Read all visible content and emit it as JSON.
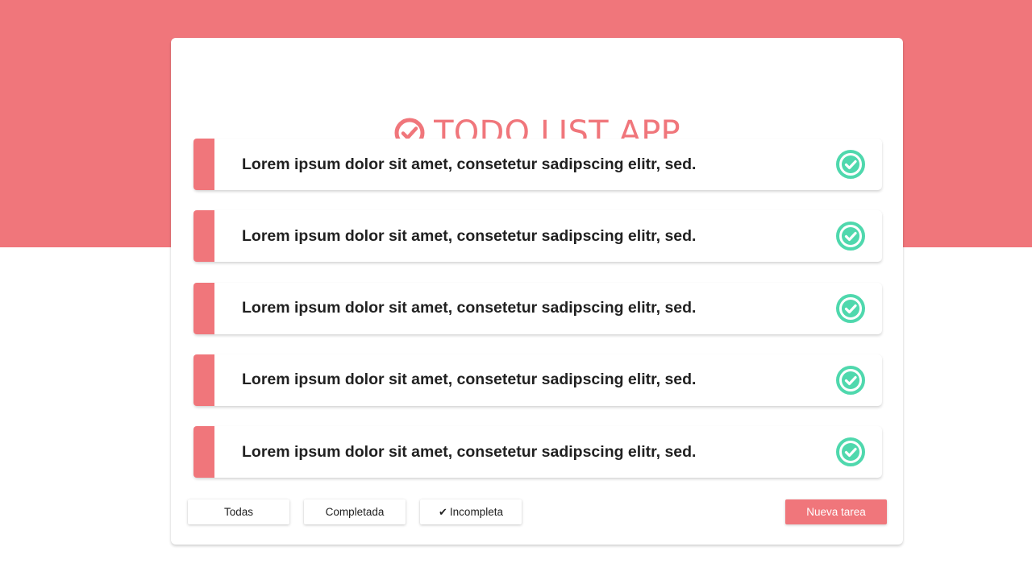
{
  "colors": {
    "accent": "#f0767b",
    "check": "#4fd8ad",
    "text": "#212121",
    "white": "#ffffff"
  },
  "header": {
    "icon": "check-circle-icon",
    "title": "TODO LIST APP"
  },
  "tasks": [
    {
      "text": "Lorem ipsum dolor sit amet, consetetur sadipscing elitr, sed.",
      "icon": "check-circle-icon"
    },
    {
      "text": "Lorem ipsum dolor sit amet, consetetur sadipscing elitr, sed.",
      "icon": "check-circle-icon"
    },
    {
      "text": "Lorem ipsum dolor sit amet, consetetur sadipscing elitr, sed.",
      "icon": "check-circle-icon"
    },
    {
      "text": "Lorem ipsum dolor sit amet, consetetur sadipscing elitr, sed.",
      "icon": "check-circle-icon"
    },
    {
      "text": "Lorem ipsum dolor sit amet, consetetur sadipscing elitr, sed.",
      "icon": "check-circle-icon"
    }
  ],
  "filters": {
    "all_label": "Todas",
    "completed_label": "Completada",
    "incomplete_label": "Incompleta",
    "active_icon": "checkmark-icon"
  },
  "actions": {
    "new_task_label": "Nueva tarea"
  }
}
